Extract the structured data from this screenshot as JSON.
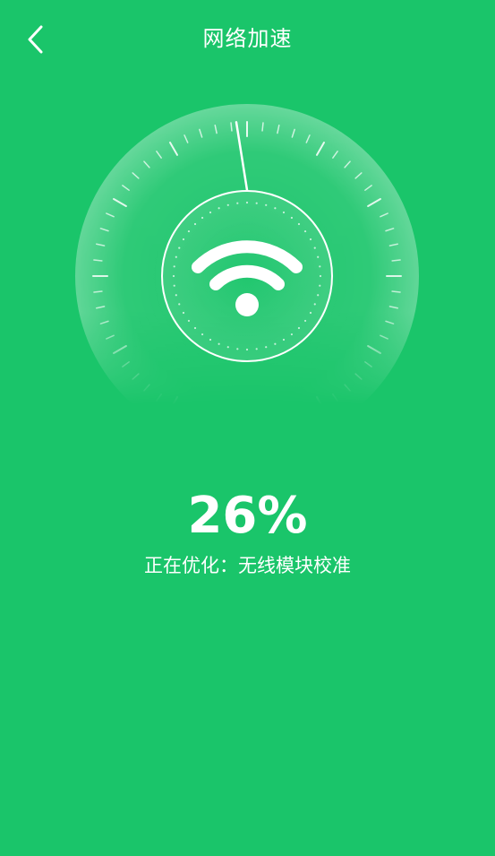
{
  "header": {
    "title": "网络加速",
    "back_icon": "chevron-left-icon"
  },
  "gauge": {
    "center_icon": "wifi-icon",
    "progress_percent": 26
  },
  "status": {
    "percent_label": "26%",
    "prefix": "正在优化：",
    "task": "无线模块校准"
  },
  "colors": {
    "background": "#1AC56A",
    "foreground": "#FFFFFF"
  }
}
